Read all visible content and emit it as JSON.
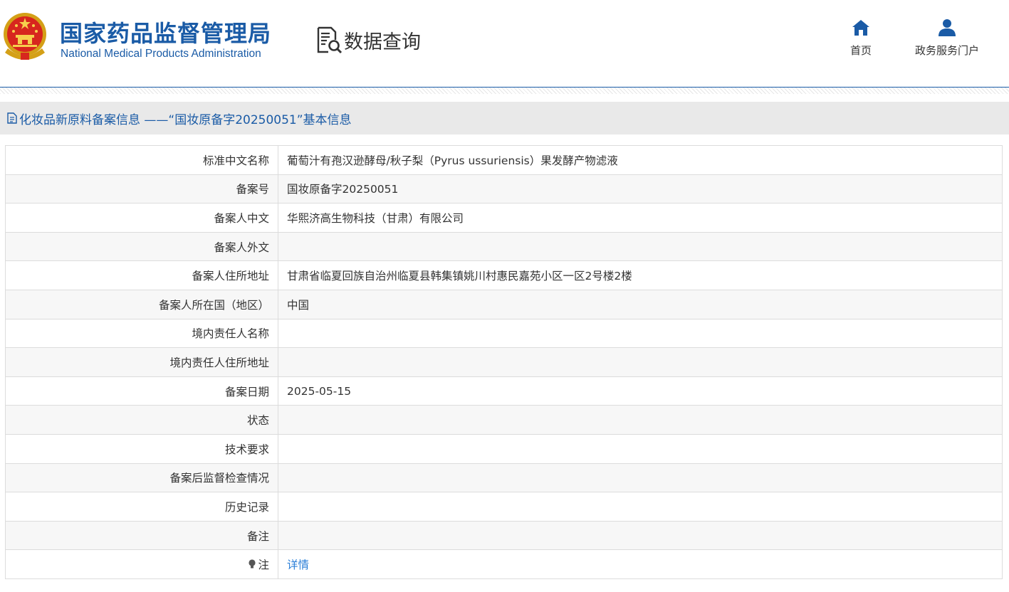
{
  "header": {
    "logo_cn": "国家药品监督管理局",
    "logo_en": "National Medical Products Administration",
    "section_name": "数据查询",
    "nav": [
      {
        "label": "首页",
        "icon": "home-icon"
      },
      {
        "label": "政务服务门户",
        "icon": "user-icon"
      }
    ]
  },
  "page_title": "化妆品新原料备案信息 ——“国妆原备字20250051”基本信息",
  "colors": {
    "brand_blue": "#1a5ba6",
    "link_blue": "#2b7fd8",
    "bar_gray": "#e9e9e9"
  },
  "rows": [
    {
      "label": "标准中文名称",
      "value": "葡萄汁有孢汉逊酵母/秋子梨（Pyrus ussuriensis）果发酵产物滤液"
    },
    {
      "label": "备案号",
      "value": "国妆原备字20250051"
    },
    {
      "label": "备案人中文",
      "value": "华熙济高生物科技（甘肃）有限公司"
    },
    {
      "label": "备案人外文",
      "value": ""
    },
    {
      "label": "备案人住所地址",
      "value": "甘肃省临夏回族自治州临夏县韩集镇姚川村惠民嘉苑小区一区2号楼2楼"
    },
    {
      "label": "备案人所在国（地区）",
      "value": "中国"
    },
    {
      "label": "境内责任人名称",
      "value": ""
    },
    {
      "label": "境内责任人住所地址",
      "value": ""
    },
    {
      "label": "备案日期",
      "value": "2025-05-15"
    },
    {
      "label": "状态",
      "value": ""
    },
    {
      "label": "技术要求",
      "value": ""
    },
    {
      "label": "备案后监督检查情况",
      "value": ""
    },
    {
      "label": "历史记录",
      "value": ""
    },
    {
      "label": "备注",
      "value": ""
    }
  ],
  "note_row": {
    "label": "注",
    "link": "详情",
    "icon": "bulb-icon"
  }
}
